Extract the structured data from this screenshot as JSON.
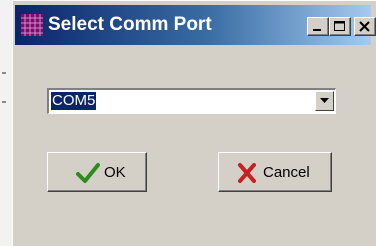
{
  "window": {
    "title": "Select Comm Port",
    "app_icon": "grid-app-icon",
    "controls": {
      "minimize_icon": "minimize-icon",
      "maximize_icon": "maximize-icon",
      "close_icon": "close-icon"
    }
  },
  "port_select": {
    "value": "COM5",
    "dropdown_icon": "chevron-down-icon"
  },
  "buttons": {
    "ok": {
      "label": "OK",
      "icon": "checkmark-icon",
      "icon_color": "#2e8b1e"
    },
    "cancel": {
      "label": "Cancel",
      "icon": "x-icon",
      "icon_color": "#c62020"
    }
  },
  "colors": {
    "titlebar_start": "#0a246a",
    "titlebar_end": "#a6caf0",
    "dialog_face": "#d4d0c8",
    "selection": "#0a246a"
  }
}
